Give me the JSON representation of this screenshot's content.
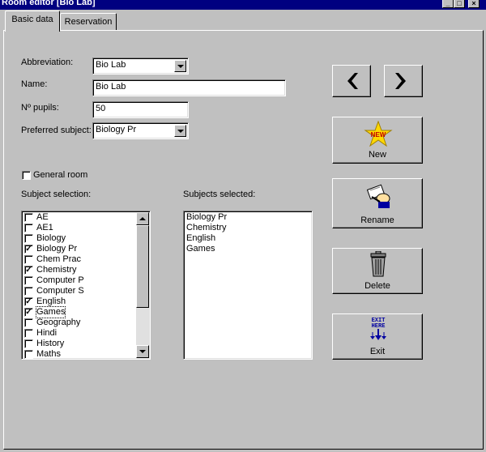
{
  "window": {
    "title": "Room editor [Bio Lab]",
    "controls": {
      "minimize": "_",
      "maximize": "□",
      "close": "×"
    }
  },
  "tabs": [
    {
      "label": "Basic data",
      "active": true
    },
    {
      "label": "Reservation",
      "active": false
    }
  ],
  "form": {
    "abbreviation": {
      "label": "Abbreviation:",
      "value": "Bio Lab"
    },
    "name": {
      "label": "Name:",
      "value": "Bio Lab"
    },
    "pupils": {
      "label": "Nº pupils:",
      "value": "50"
    },
    "preferred_subject": {
      "label": "Preferred subject:",
      "value": "Biology Pr"
    },
    "general_room": {
      "label": "General room",
      "checked": false
    }
  },
  "subject_selection": {
    "label": "Subject selection:",
    "items": [
      {
        "name": "AE",
        "checked": false
      },
      {
        "name": "AE1",
        "checked": false
      },
      {
        "name": "Biology",
        "checked": false
      },
      {
        "name": "Biology Pr",
        "checked": true
      },
      {
        "name": "Chem Prac",
        "checked": false
      },
      {
        "name": "Chemistry",
        "checked": true
      },
      {
        "name": "Computer P",
        "checked": false
      },
      {
        "name": "Computer S",
        "checked": false
      },
      {
        "name": "English",
        "checked": true
      },
      {
        "name": "Games",
        "checked": true
      },
      {
        "name": "Geography",
        "checked": false
      },
      {
        "name": "Hindi",
        "checked": false
      },
      {
        "name": "History",
        "checked": false
      },
      {
        "name": "Maths",
        "checked": false
      }
    ]
  },
  "subjects_selected": {
    "label": "Subjects selected:",
    "items": [
      "Biology Pr",
      "Chemistry",
      "English",
      "Games"
    ]
  },
  "buttons": {
    "prev_icon": "arrow-left-icon",
    "next_icon": "arrow-right-icon",
    "new": {
      "label": "New",
      "icon": "new-star-icon",
      "icon_text": "NEW"
    },
    "rename": {
      "label": "Rename",
      "icon": "rename-hand-icon"
    },
    "delete": {
      "label": "Delete",
      "icon": "trash-can-icon"
    },
    "exit": {
      "label": "Exit",
      "icon": "exit-here-icon",
      "icon_text_line1": "EXIT",
      "icon_text_line2": "HERE"
    }
  },
  "colors": {
    "titlebar": "#000080",
    "face": "#c0c0c0",
    "star": "#ffd800"
  }
}
